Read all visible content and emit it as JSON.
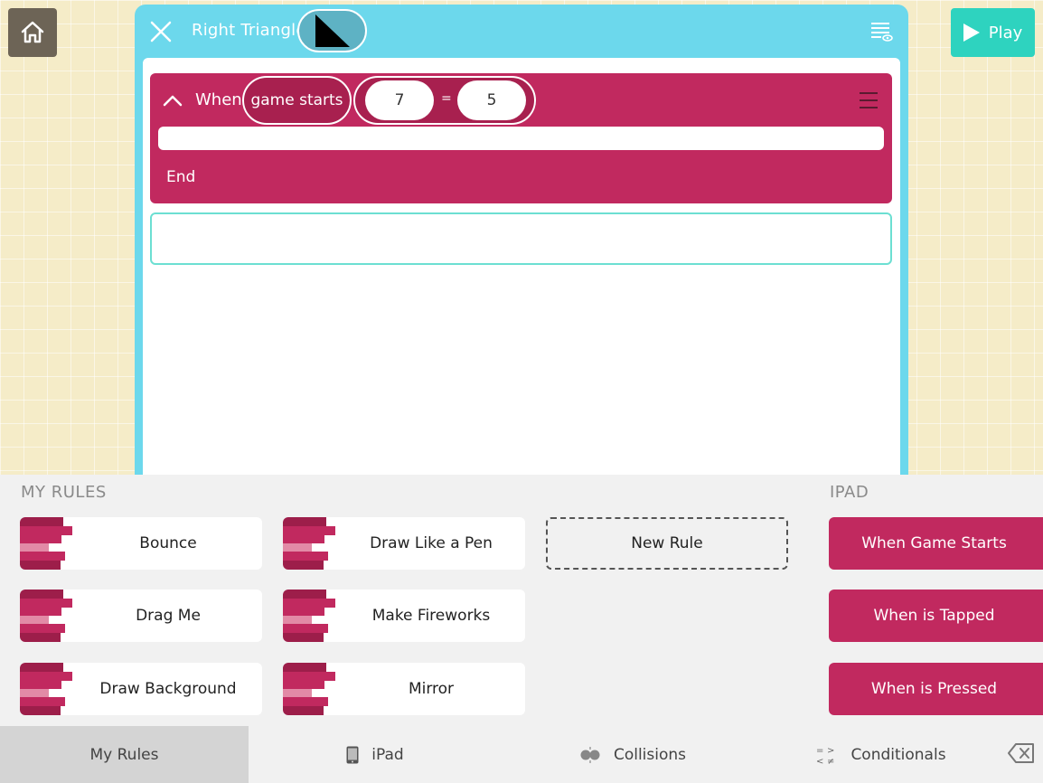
{
  "topbar": {
    "home_icon": "home-icon",
    "play_label": "Play",
    "play_icon": "play-icon"
  },
  "editor": {
    "object_name": "Right Triangle",
    "close_icon": "close-icon",
    "script_view_icon": "script-view-icon",
    "rule": {
      "when_label": "When",
      "trigger": "game starts",
      "condition": {
        "left": "7",
        "operator": "=",
        "right": "5"
      },
      "end_label": "End"
    }
  },
  "palette": {
    "my_rules_title": "MY RULES",
    "my_rules": [
      {
        "label": "Bounce"
      },
      {
        "label": "Drag Me"
      },
      {
        "label": "Draw Background"
      },
      {
        "label": "Draw Like a Pen"
      },
      {
        "label": "Make Fireworks"
      },
      {
        "label": "Mirror"
      }
    ],
    "new_rule_label": "New Rule",
    "ipad_title": "IPAD",
    "ipad_rules": [
      {
        "label": "When Game Starts"
      },
      {
        "label": "When is Tapped"
      },
      {
        "label": "When is Pressed"
      }
    ]
  },
  "tabs": [
    {
      "label": "My Rules",
      "icon": "",
      "active": true
    },
    {
      "label": "iPad",
      "icon": "ipad-icon",
      "active": false
    },
    {
      "label": "Collisions",
      "icon": "collisions-icon",
      "active": false
    },
    {
      "label": "Conditionals",
      "icon": "conditionals-icon",
      "active": false
    }
  ],
  "colors": {
    "rule_magenta": "#c1295f",
    "editor_blue": "#6cd8ec",
    "play_teal": "#2ed3bf",
    "background_cream": "#f5ecc8"
  }
}
